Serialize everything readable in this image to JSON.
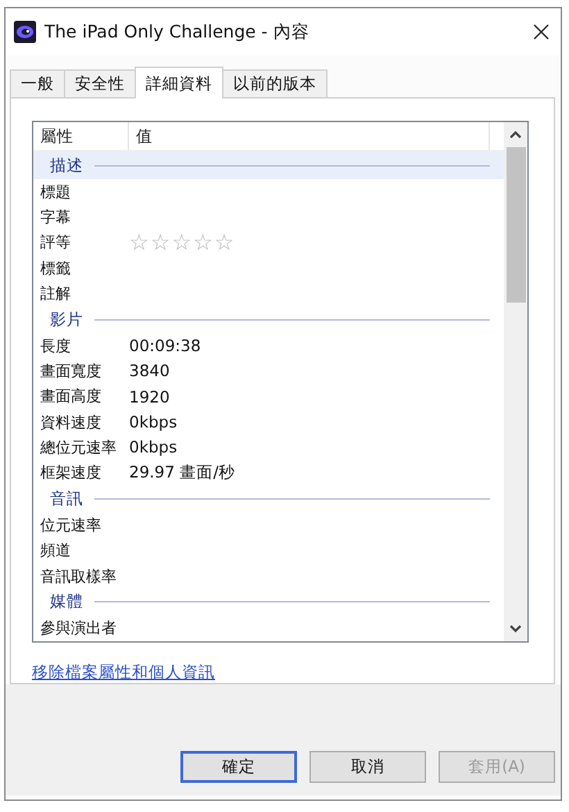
{
  "window": {
    "title": "The iPad Only Challenge - 內容"
  },
  "tabs": [
    {
      "label": "一般",
      "selected": false
    },
    {
      "label": "安全性",
      "selected": false
    },
    {
      "label": "詳細資料",
      "selected": true
    },
    {
      "label": "以前的版本",
      "selected": false
    }
  ],
  "table": {
    "columns": [
      "屬性",
      "值"
    ],
    "groups": [
      {
        "name": "描述",
        "selected": true,
        "items": [
          {
            "kind": "text",
            "name": "標題"
          },
          {
            "kind": "text",
            "name": "字幕"
          },
          {
            "kind": "rating",
            "name": "評等",
            "stars": 0
          },
          {
            "kind": "text",
            "name": "標籤"
          },
          {
            "kind": "text",
            "name": "註解"
          }
        ]
      },
      {
        "name": "影片",
        "selected": false,
        "items": [
          {
            "kind": "text",
            "name": "長度",
            "value": "00:09:38"
          },
          {
            "kind": "text",
            "name": "畫面寬度",
            "value": "3840"
          },
          {
            "kind": "text",
            "name": "畫面高度",
            "value": "1920"
          },
          {
            "kind": "text",
            "name": "資料速度",
            "value": "0kbps"
          },
          {
            "kind": "text",
            "name": "總位元速率",
            "value": "0kbps"
          },
          {
            "kind": "text",
            "name": "框架速度",
            "value": "29.97 畫面/秒"
          }
        ]
      },
      {
        "name": "音訊",
        "selected": false,
        "items": [
          {
            "kind": "text",
            "name": "位元速率"
          },
          {
            "kind": "text",
            "name": "頻道"
          },
          {
            "kind": "text",
            "name": "音訊取樣率"
          }
        ]
      },
      {
        "name": "媒體",
        "selected": false,
        "items": [
          {
            "kind": "text",
            "name": "參與演出者"
          }
        ]
      }
    ]
  },
  "link": "移除檔案屬性和個人資訊",
  "buttons": [
    {
      "label": "確定",
      "default": true,
      "disabled": false
    },
    {
      "label": "取消",
      "default": false,
      "disabled": false
    },
    {
      "label": "套用(A)",
      "default": false,
      "disabled": true
    }
  ]
}
